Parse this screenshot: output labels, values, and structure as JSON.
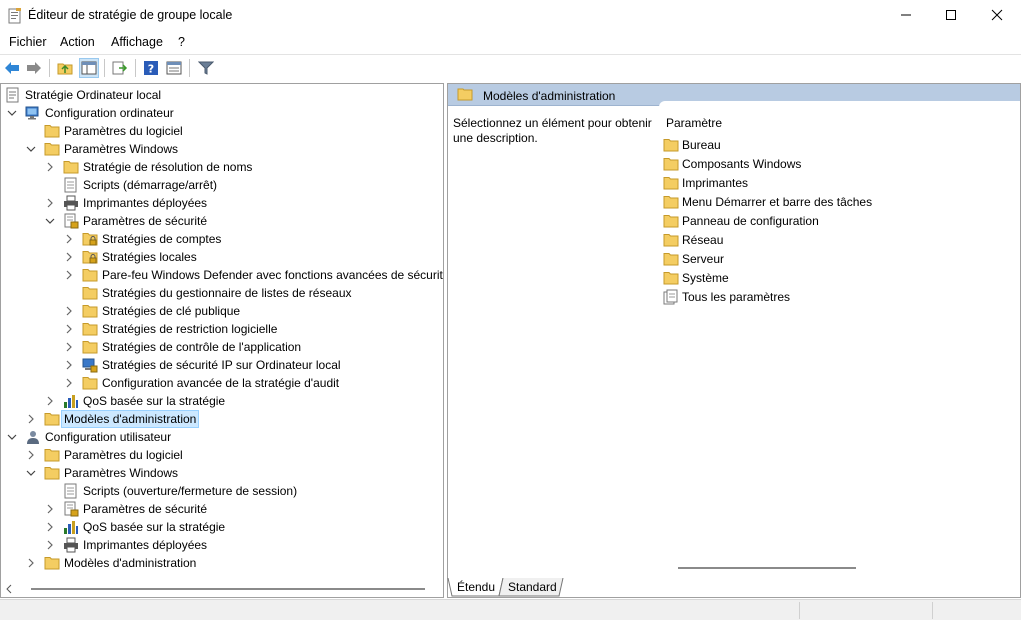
{
  "window": {
    "title": "Éditeur de stratégie de groupe locale",
    "icon": "policy-editor-icon"
  },
  "menu": [
    "Fichier",
    "Action",
    "Affichage",
    "?"
  ],
  "toolbar": {
    "buttons": [
      "back-arrow-icon",
      "forward-arrow-icon",
      "up-folder-icon",
      "show-hide-tree-icon",
      "export-list-icon",
      "help-icon",
      "properties-icon",
      "filter-icon"
    ]
  },
  "tree": {
    "items": [
      {
        "label": "Stratégie Ordinateur local",
        "icon": "policy-doc-icon",
        "level": 0,
        "chevron": "none"
      },
      {
        "label": "Configuration ordinateur",
        "icon": "computer-icon",
        "level": 1,
        "chevron": "down"
      },
      {
        "label": "Paramètres du logiciel",
        "icon": "folder-icon",
        "level": 2,
        "chevron": "none"
      },
      {
        "label": "Paramètres Windows",
        "icon": "folder-icon",
        "level": 2,
        "chevron": "down"
      },
      {
        "label": "Stratégie de résolution de noms",
        "icon": "folder-icon",
        "level": 3,
        "chevron": "right"
      },
      {
        "label": "Scripts (démarrage/arrêt)",
        "icon": "script-icon",
        "level": 3,
        "chevron": "none"
      },
      {
        "label": "Imprimantes déployées",
        "icon": "printer-icon",
        "level": 3,
        "chevron": "right"
      },
      {
        "label": "Paramètres de sécurité",
        "icon": "security-settings-icon",
        "level": 3,
        "chevron": "down"
      },
      {
        "label": "Stratégies de comptes",
        "icon": "locked-folder-icon",
        "level": 4,
        "chevron": "right"
      },
      {
        "label": "Stratégies locales",
        "icon": "locked-folder-icon",
        "level": 4,
        "chevron": "right"
      },
      {
        "label": "Pare-feu Windows Defender avec fonctions avancées de sécurité",
        "icon": "folder-icon",
        "level": 4,
        "chevron": "right"
      },
      {
        "label": "Stratégies du gestionnaire de listes de réseaux",
        "icon": "folder-icon",
        "level": 4,
        "chevron": "none"
      },
      {
        "label": "Stratégies de clé publique",
        "icon": "folder-icon",
        "level": 4,
        "chevron": "right"
      },
      {
        "label": "Stratégies de restriction logicielle",
        "icon": "folder-icon",
        "level": 4,
        "chevron": "right"
      },
      {
        "label": "Stratégies de contrôle de l'application",
        "icon": "folder-icon",
        "level": 4,
        "chevron": "right"
      },
      {
        "label": "Stratégies de sécurité IP sur Ordinateur local",
        "icon": "ip-security-icon",
        "level": 4,
        "chevron": "right"
      },
      {
        "label": "Configuration avancée de la stratégie d'audit",
        "icon": "folder-icon",
        "level": 4,
        "chevron": "right"
      },
      {
        "label": "QoS basée sur la stratégie",
        "icon": "qos-chart-icon",
        "level": 3,
        "chevron": "right"
      },
      {
        "label": "Modèles d'administration",
        "icon": "folder-icon",
        "level": 2,
        "chevron": "right",
        "selected": true
      },
      {
        "label": "Configuration utilisateur",
        "icon": "user-icon",
        "level": 1,
        "chevron": "down"
      },
      {
        "label": "Paramètres du logiciel",
        "icon": "folder-icon",
        "level": 2,
        "chevron": "right"
      },
      {
        "label": "Paramètres Windows",
        "icon": "folder-icon",
        "level": 2,
        "chevron": "down"
      },
      {
        "label": "Scripts (ouverture/fermeture de session)",
        "icon": "script-icon",
        "level": 3,
        "chevron": "none"
      },
      {
        "label": "Paramètres de sécurité",
        "icon": "security-settings-icon",
        "level": 3,
        "chevron": "right"
      },
      {
        "label": "QoS basée sur la stratégie",
        "icon": "qos-chart-icon",
        "level": 3,
        "chevron": "right"
      },
      {
        "label": "Imprimantes déployées",
        "icon": "printer-icon",
        "level": 3,
        "chevron": "right"
      },
      {
        "label": "Modèles d'administration",
        "icon": "folder-icon",
        "level": 2,
        "chevron": "right"
      }
    ]
  },
  "right": {
    "header": "Modèles d'administration",
    "description": "Sélectionnez un élément pour obtenir une description.",
    "column_header": "Paramètre",
    "items": [
      {
        "label": "Bureau",
        "icon": "folder-icon"
      },
      {
        "label": "Composants Windows",
        "icon": "folder-icon"
      },
      {
        "label": "Imprimantes",
        "icon": "folder-icon"
      },
      {
        "label": "Menu Démarrer et barre des tâches",
        "icon": "folder-icon"
      },
      {
        "label": "Panneau de configuration",
        "icon": "folder-icon"
      },
      {
        "label": "Réseau",
        "icon": "folder-icon"
      },
      {
        "label": "Serveur",
        "icon": "folder-icon"
      },
      {
        "label": "Système",
        "icon": "folder-icon"
      },
      {
        "label": "Tous les paramètres",
        "icon": "all-settings-icon"
      }
    ]
  },
  "tabs": [
    "Étendu",
    "Standard"
  ],
  "colors": {
    "folder": "#f4cd62",
    "header_bg": "#b8cbe2",
    "selection_bg": "#cce8ff"
  }
}
